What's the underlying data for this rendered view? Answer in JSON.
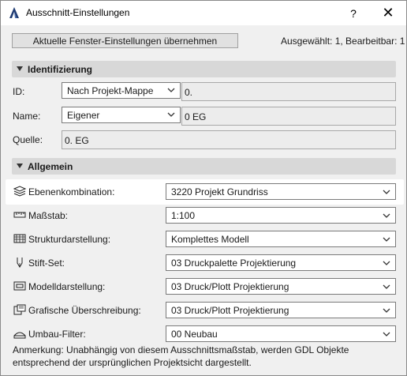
{
  "window": {
    "title": "Ausschnitt-Einstellungen",
    "help_glyph": "?",
    "close_glyph": "✕"
  },
  "toolbar": {
    "apply_label": "Aktuelle Fenster-Einstellungen übernehmen",
    "selection_info": "Ausgewählt: 1, Bearbeitbar: 1"
  },
  "identification": {
    "header": "Identifizierung",
    "id_label": "ID:",
    "id_source": "Nach Projekt-Mappe",
    "id_value": "0.",
    "name_label": "Name:",
    "name_source": "Eigener",
    "name_value": "0 EG",
    "source_label": "Quelle:",
    "source_value": "0. EG"
  },
  "general": {
    "header": "Allgemein",
    "rows": [
      {
        "label": "Ebenenkombination:",
        "value": "3220 Projekt Grundriss",
        "icon": "layers-icon"
      },
      {
        "label": "Maßstab:",
        "value": "1:100",
        "icon": "ruler-icon"
      },
      {
        "label": "Strukturdarstellung:",
        "value": "Komplettes Modell",
        "icon": "structure-icon"
      },
      {
        "label": "Stift-Set:",
        "value": "03 Druckpalette Projektierung",
        "icon": "pen-icon"
      },
      {
        "label": "Modelldarstellung:",
        "value": "03 Druck/Plott Projektierung",
        "icon": "model-display-icon"
      },
      {
        "label": "Grafische Überschreibung:",
        "value": "03 Druck/Plott Projektierung",
        "icon": "graphic-override-icon"
      },
      {
        "label": "Umbau-Filter:",
        "value": "00 Neubau",
        "icon": "renovation-filter-icon"
      }
    ],
    "note": "Anmerkung: Unabhängig von diesem Ausschnittsmaßstab, werden GDL Objekte entsprechend der ursprünglichen Projektsicht dargestellt."
  },
  "colors": {
    "section_bg": "#d8d8d8",
    "highlight_row": "#ffffff",
    "app_icon": "#1f3b73"
  }
}
